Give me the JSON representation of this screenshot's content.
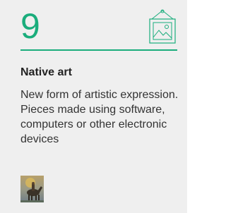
{
  "card": {
    "number": "9",
    "title": "Native art",
    "description": "New form of artistic expression. Pieces made using software, computers or other electronic devices",
    "accent_color": "#1aad7c",
    "icon": "framed-picture-icon",
    "thumbnail": "artwork-thumbnail"
  }
}
